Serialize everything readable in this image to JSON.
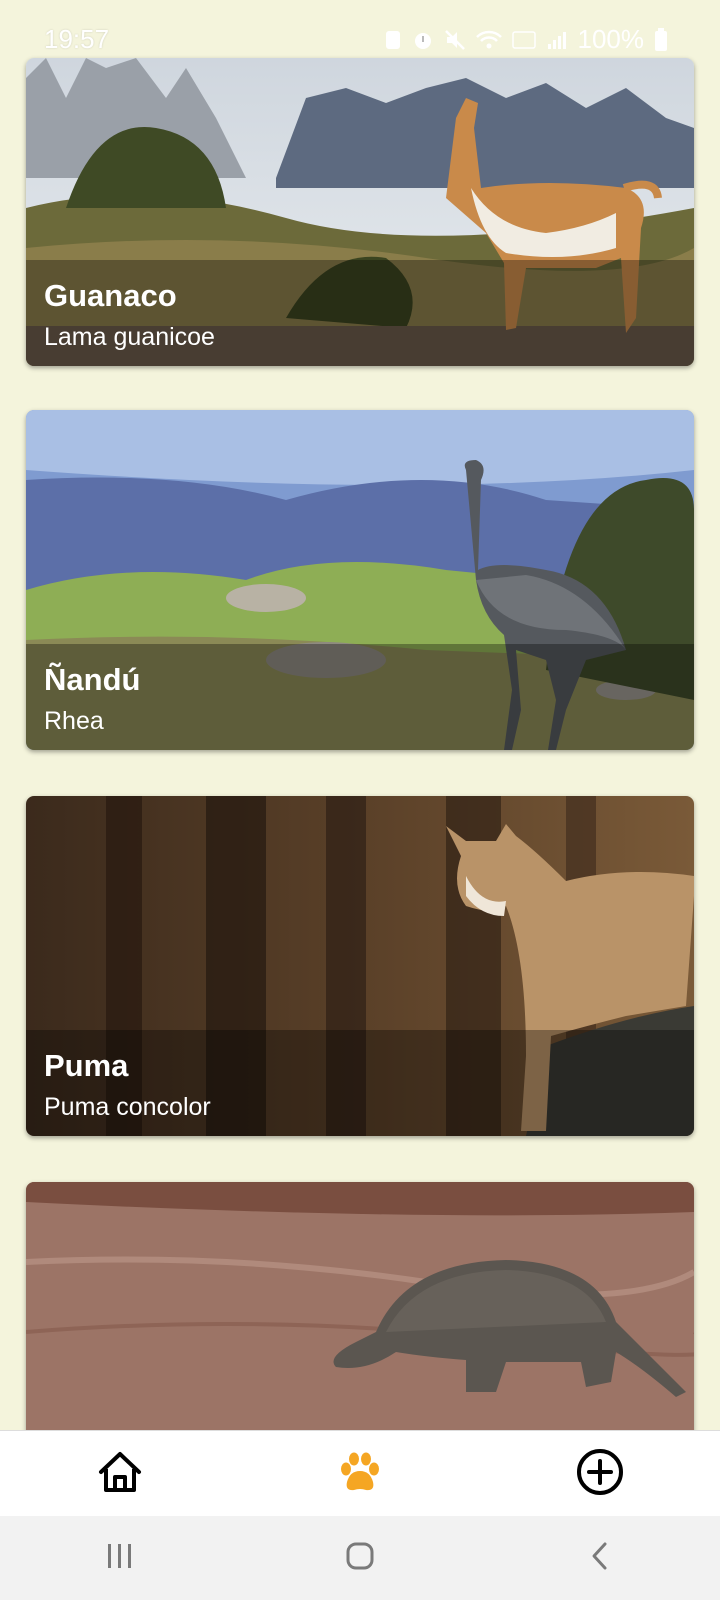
{
  "status_bar": {
    "time": "19:57",
    "battery": "100%",
    "icons": [
      "notification-icon",
      "alarm-icon",
      "mute-icon",
      "wifi-icon",
      "volte-icon",
      "signal-icon",
      "battery-icon"
    ]
  },
  "animals": [
    {
      "name": "Guanaco",
      "scientific": "Lama guanicoe"
    },
    {
      "name": "Ñandú",
      "scientific": "Rhea"
    },
    {
      "name": "Puma",
      "scientific": "Puma concolor"
    },
    {
      "name": "",
      "scientific": ""
    }
  ],
  "bottom_nav": {
    "items": [
      "home-icon",
      "paw-icon",
      "add-circle-icon"
    ],
    "active": "paw-icon",
    "active_color": "#f5a623"
  },
  "system_nav": [
    "recents-icon",
    "home-button-icon",
    "back-icon"
  ]
}
